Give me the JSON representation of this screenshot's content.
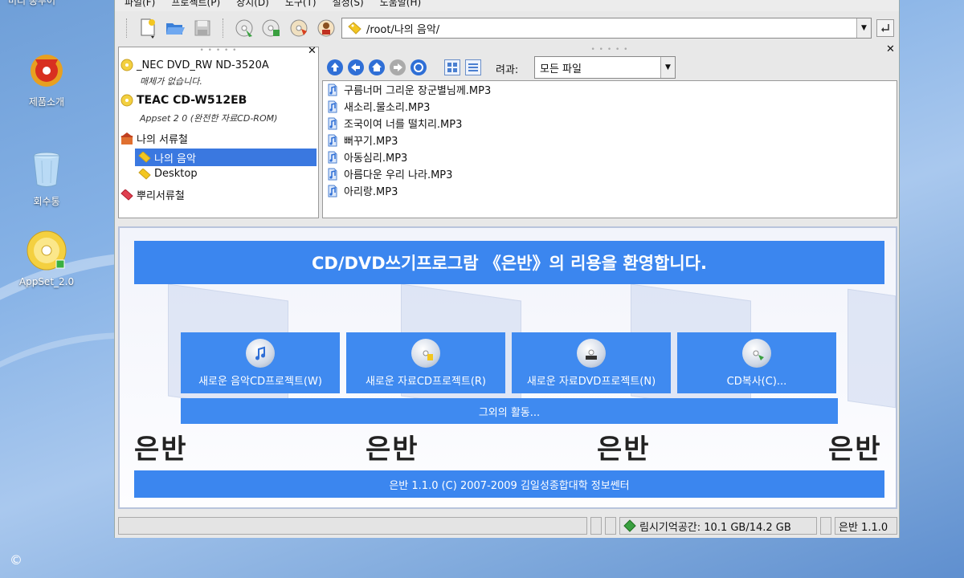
{
  "desktop": {
    "top_label": "미리 봉투어",
    "icons": [
      {
        "label": "제품소개",
        "icon": "gear-logo-icon"
      },
      {
        "label": "회수통",
        "icon": "trash-icon"
      },
      {
        "label": "AppSet_2.0",
        "icon": "cd-icon"
      }
    ],
    "copyright": "©"
  },
  "menubar": [
    "파일(F)",
    "프로젝트(P)",
    "장치(D)",
    "도구(T)",
    "설정(S)",
    "도움말(H)"
  ],
  "toolbar": {
    "path": "/root/나의 음악/"
  },
  "tree": {
    "items": [
      {
        "label": "_NEC DVD_RW ND-3520A",
        "sub": "매체가 없습니다."
      },
      {
        "label": "TEAC CD-W512EB",
        "sub": "Appset 2 0 (완전한 자료CD-ROM)"
      },
      {
        "label": "나의 서류철"
      },
      {
        "label": "나의 음악"
      },
      {
        "label": "Desktop"
      },
      {
        "label": "뿌리서류철"
      }
    ]
  },
  "file_pane": {
    "filter_label": "려과:",
    "filter_value": "모든 파일",
    "files": [
      "구름너머 그리운 장군별님께.MP3",
      "새소리.물소리.MP3",
      "조국이여 너를 떨치리.MP3",
      "뻐꾸기.MP3",
      "아동심리.MP3",
      "아름다운 우리 나라.MP3",
      "아리랑.MP3"
    ]
  },
  "welcome": {
    "banner": "CD/DVD쓰기프로그람 《은반》의 리용을 환영합니다.",
    "watermark": "은반",
    "actions": [
      {
        "label": "새로운 음악CD프로젝트(W)",
        "icon": "music-cd-icon"
      },
      {
        "label": "새로운 자료CD프로젝트(R)",
        "icon": "data-cd-icon"
      },
      {
        "label": "새로운 자료DVD프로젝트(N)",
        "icon": "data-dvd-icon"
      },
      {
        "label": "CD복사(C)...",
        "icon": "cd-copy-icon"
      }
    ],
    "other": "그외의 활동...",
    "footer": "은반 1.1.0 (C) 2007-2009 김일성종합대학 정보쎈터"
  },
  "status": {
    "temp_space": "림시기억공간: 10.1 GB/14.2 GB",
    "version": "은반 1.1.0"
  },
  "colors": {
    "accent": "#3b86ef",
    "selection": "#3a78e0"
  }
}
